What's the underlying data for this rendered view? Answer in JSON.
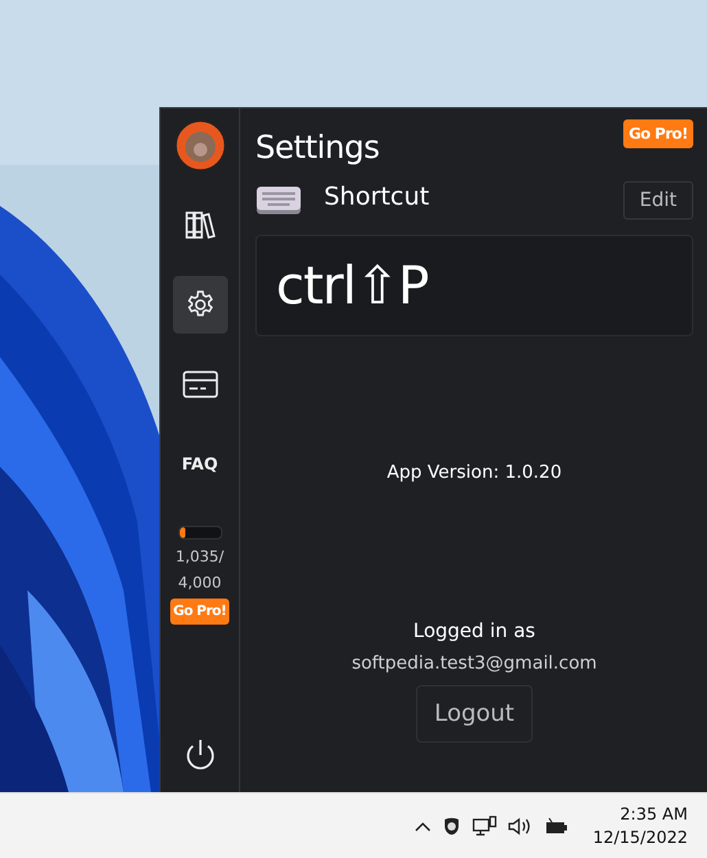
{
  "window": {
    "title": "Settings",
    "upgrade_button": "Go Pro!"
  },
  "sidebar": {
    "items": [
      {
        "kind": "books",
        "selected": false
      },
      {
        "kind": "gear",
        "selected": true
      },
      {
        "kind": "card",
        "selected": false
      },
      {
        "kind": "text",
        "label": "FAQ",
        "selected": false
      }
    ],
    "usage": {
      "level": 0.15,
      "count": "1,035/",
      "limit": "4,000",
      "button": "Go Pro!"
    }
  },
  "shortcut": {
    "label": "Shortcut",
    "edit_button": "Edit",
    "keys": "ctrl⇧P"
  },
  "app_version": "App Version: 1.0.20",
  "account": {
    "caption": "Logged in as",
    "email": "softpedia.test3@gmail.com",
    "logout_button": "Logout"
  },
  "taskbar": {
    "time": "2:35 AM",
    "date": "12/15/2022"
  }
}
